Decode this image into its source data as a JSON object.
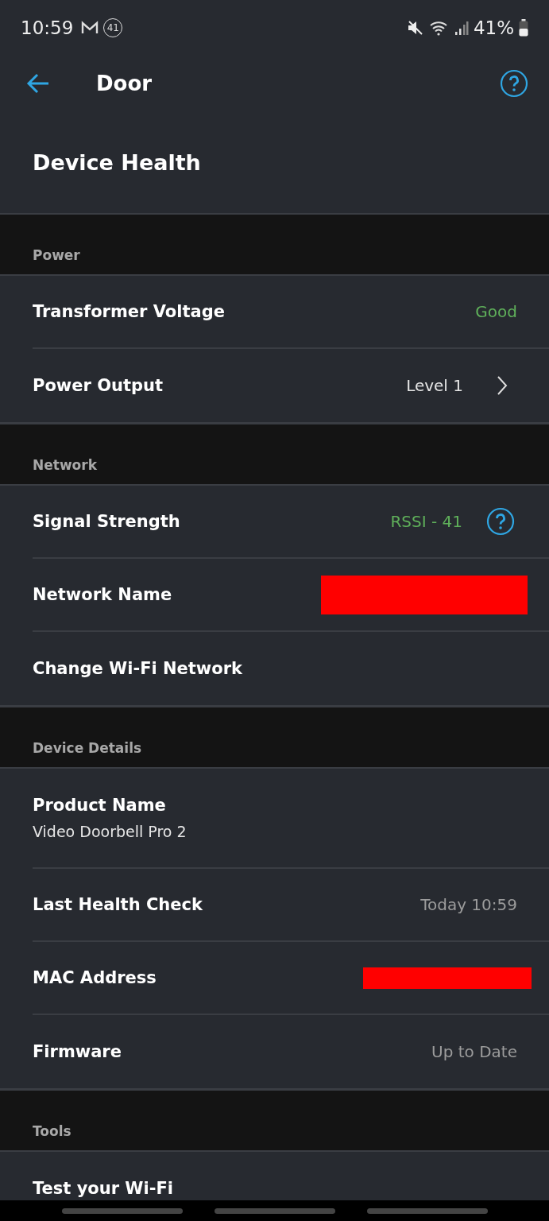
{
  "status_bar": {
    "time": "10:59",
    "notification_count": "41",
    "battery": "41%"
  },
  "header": {
    "title": "Door"
  },
  "page_title": "Device Health",
  "sections": [
    {
      "title": "Power",
      "rows": [
        {
          "kind": "value",
          "label": "Transformer Voltage",
          "value": "Good",
          "color": "#5fb05a"
        },
        {
          "kind": "link",
          "label": "Power Output",
          "value": "Level 1",
          "color": "#e6e6e6"
        }
      ]
    },
    {
      "title": "Network",
      "rows": [
        {
          "kind": "help",
          "label": "Signal Strength",
          "value": "RSSI - 41",
          "color": "#5fb05a"
        },
        {
          "kind": "redacted",
          "label": "Network Name"
        },
        {
          "kind": "plain",
          "label": "Change Wi-Fi Network"
        }
      ]
    },
    {
      "title": "Device Details",
      "rows": [
        {
          "kind": "stacked",
          "label": "Product Name",
          "value": "Video Doorbell Pro 2",
          "color": "#e6e6e6"
        },
        {
          "kind": "value",
          "label": "Last Health Check",
          "value": "Today 10:59",
          "color": "#9c9c9c"
        },
        {
          "kind": "redacted",
          "label": "MAC Address"
        },
        {
          "kind": "value",
          "label": "Firmware",
          "value": "Up to Date",
          "color": "#9c9c9c"
        }
      ]
    },
    {
      "title": "Tools",
      "rows": [
        {
          "kind": "plain",
          "label": "Test your Wi-Fi"
        }
      ]
    }
  ]
}
